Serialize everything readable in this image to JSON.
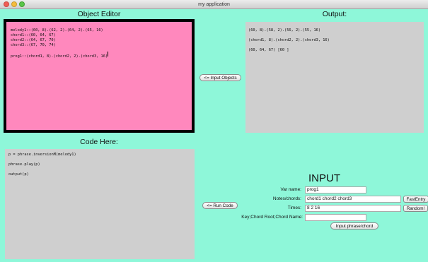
{
  "window": {
    "title": "my application"
  },
  "editor": {
    "heading": "Object Editor",
    "lines": [
      "melody1::(60, 8).(62, 2).(64, 2).(65, 16)",
      "chord1::(60, 64, 67)",
      "chord2::(64, 67, 70)",
      "chord3::(67, 70, 74)",
      "",
      "prog1::(chord1, 8).(chord2, 2).(chord3, 16)"
    ]
  },
  "output": {
    "heading": "Output:",
    "lines": [
      "(60, 8).(58, 2).(56, 2).(55, 16)",
      "(chord1, 8).(chord2, 2).(chord3, 16)",
      "(60, 64, 67) [60 ]"
    ]
  },
  "code": {
    "heading": "Code Here:",
    "lines": [
      "p = phrase.inversionM(melody1)",
      "phrase.play(p)",
      "output(p)"
    ]
  },
  "buttons": {
    "input_objects": "<= Input Objects",
    "run_code": "<= Run Code",
    "fast_entry": "FastEntry",
    "random": "Random!",
    "input_phrase_chord": "Input phrase/chord"
  },
  "input_panel": {
    "title": "INPUT",
    "var_name_label": "Var name:",
    "var_name_value": "prog1",
    "notes_label": "Notes/chords:",
    "notes_value": "chord1 chord2 chord3",
    "times_label": "Times:",
    "times_value": "8 2 16",
    "key_label": "Key;Chord Root;Chord Name:",
    "key_value": ""
  }
}
